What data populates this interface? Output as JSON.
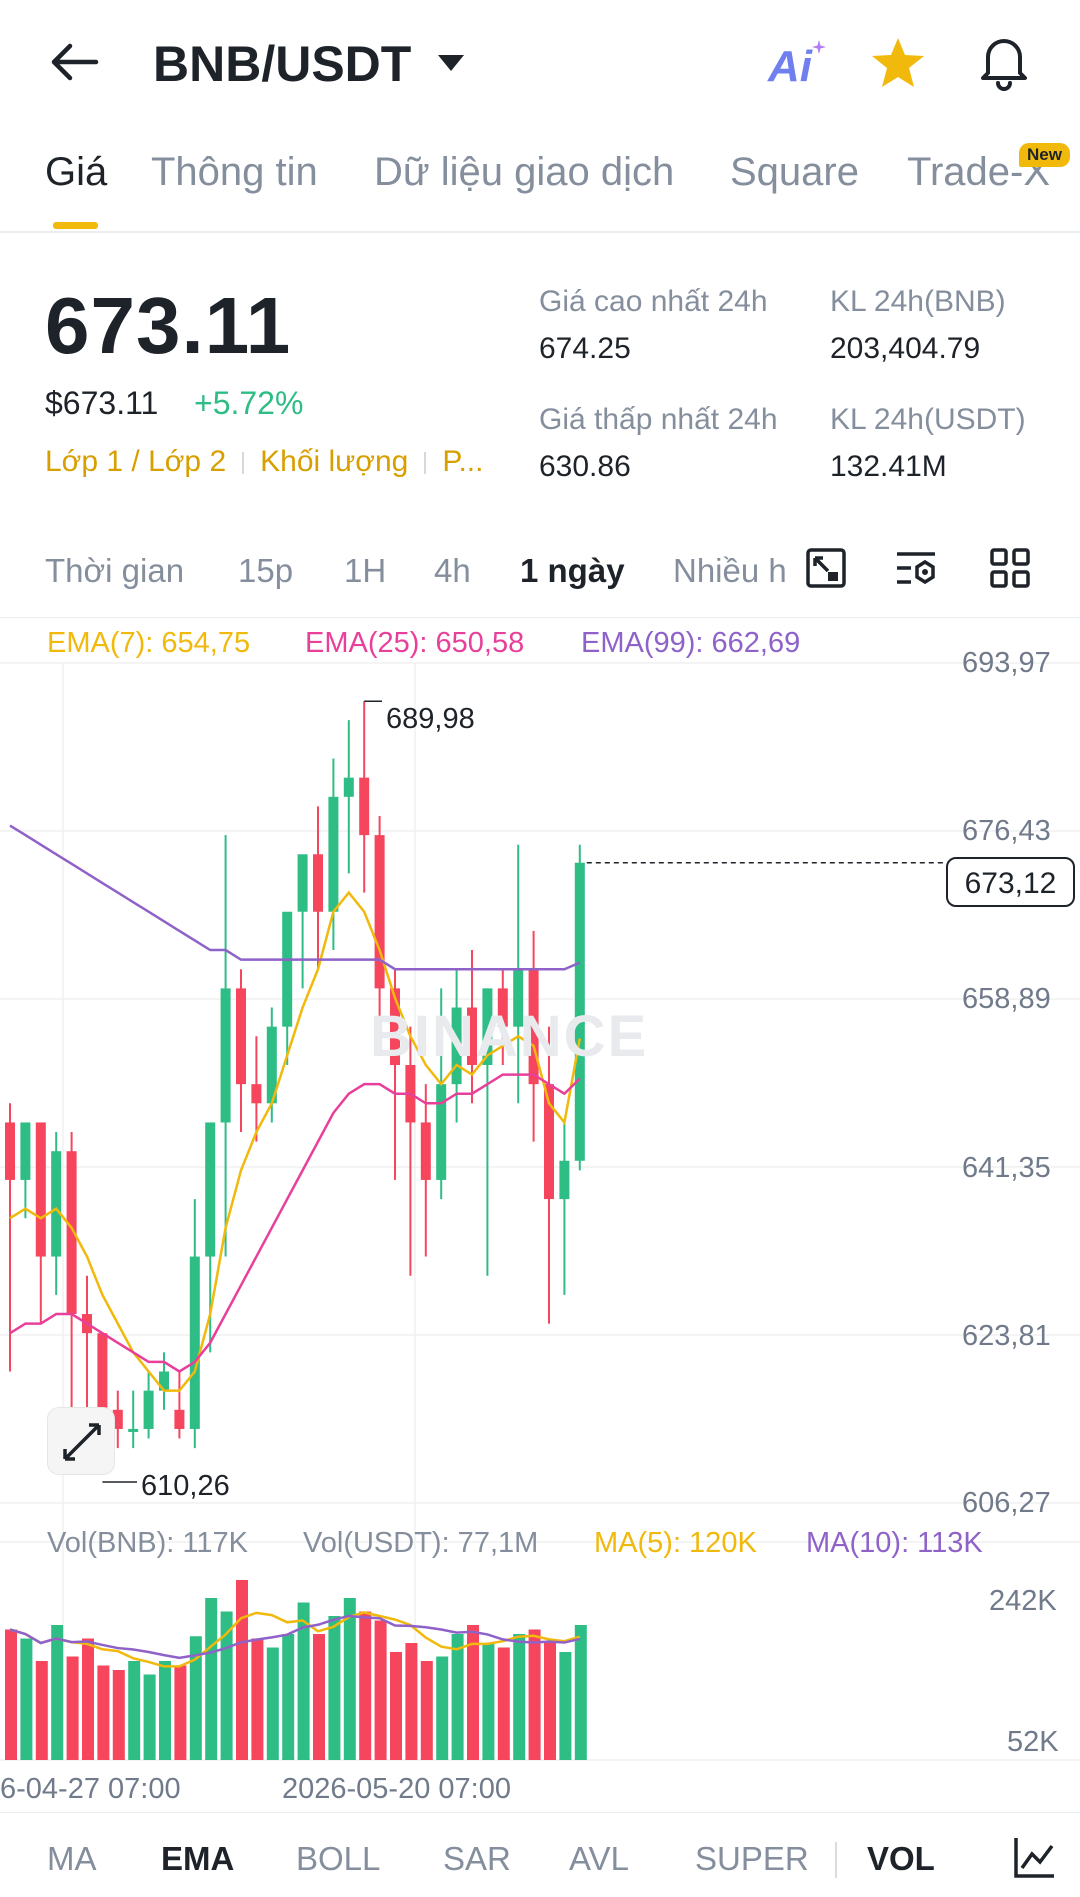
{
  "header": {
    "pair": "BNB/USDT",
    "ai_label": "Ai",
    "icons": [
      "back-arrow-icon",
      "caret-down-icon",
      "ai-icon",
      "star-icon",
      "bell-icon"
    ]
  },
  "tabs": [
    {
      "label": "Giá",
      "active": true
    },
    {
      "label": "Thông tin"
    },
    {
      "label": "Dữ liệu giao dịch"
    },
    {
      "label": "Square"
    },
    {
      "label": "Trade-X"
    }
  ],
  "new_badge": "New",
  "price": {
    "last": "673.11",
    "usd": "$673.11",
    "change": "+5.72%",
    "tags": [
      "Lớp 1 / Lớp 2",
      "Khối lượng",
      "P..."
    ]
  },
  "stats": {
    "high_label": "Giá cao nhất 24h",
    "high_value": "674.25",
    "low_label": "Giá thấp nhất 24h",
    "low_value": "630.86",
    "vol_bnb_label": "KL 24h(BNB)",
    "vol_bnb_value": "203,404.79",
    "vol_usdt_label": "KL 24h(USDT)",
    "vol_usdt_value": "132.41M"
  },
  "intervals": [
    "Thời gian",
    "15p",
    "1H",
    "4h",
    "1 ngày",
    "Nhiều h"
  ],
  "active_interval": "1 ngày",
  "toolbar_icons": [
    "chart-type-icon",
    "indicator-settings-icon",
    "grid-layout-icon"
  ],
  "ema_legend": {
    "ema7": "EMA(7): 654,75",
    "ema25": "EMA(25): 650,58",
    "ema99": "EMA(99): 662,69"
  },
  "price_axis": [
    "693,97",
    "676,43",
    "658,89",
    "641,35",
    "623,81",
    "606,27"
  ],
  "current_price_label": "673,12",
  "high_marker": "689,98",
  "low_marker": "610,26",
  "watermark": "BINANCE",
  "vol_legend": {
    "vol_bnb": "Vol(BNB): 117K",
    "vol_usdt": "Vol(USDT): 77,1M",
    "ma5": "MA(5): 120K",
    "ma10": "MA(10): 113K"
  },
  "vol_axis": [
    "242K",
    "52K"
  ],
  "time_axis": [
    "6-04-27 07:00",
    "2026-05-20 07:00"
  ],
  "indicators": [
    "MA",
    "EMA",
    "BOLL",
    "SAR",
    "AVL",
    "SUPER",
    "VOL"
  ],
  "active_indicators": [
    "EMA",
    "VOL"
  ],
  "colors": {
    "up": "#2ebd85",
    "down": "#f6465d",
    "brand": "#f0b90b",
    "ema7": "#f0b90b",
    "ema25": "#e8409a",
    "ema99": "#8f62c9"
  },
  "chart_data": {
    "type": "candlestick",
    "y_range": [
      606.27,
      693.97
    ],
    "candles": [
      {
        "o": 646,
        "h": 648,
        "c": 640,
        "l": 620
      },
      {
        "o": 640,
        "h": 646,
        "c": 646,
        "l": 636
      },
      {
        "o": 646,
        "h": 646,
        "c": 632,
        "l": 625
      },
      {
        "o": 632,
        "h": 645,
        "c": 643,
        "l": 628
      },
      {
        "o": 643,
        "h": 645,
        "c": 626,
        "l": 615
      },
      {
        "o": 626,
        "h": 630,
        "c": 624,
        "l": 614
      },
      {
        "o": 624,
        "h": 624,
        "c": 616,
        "l": 611
      },
      {
        "o": 616,
        "h": 618,
        "c": 614,
        "l": 612
      },
      {
        "o": 614,
        "h": 618,
        "c": 614,
        "l": 612
      },
      {
        "o": 614,
        "h": 620,
        "c": 618,
        "l": 613
      },
      {
        "o": 618,
        "h": 622,
        "c": 620,
        "l": 616
      },
      {
        "o": 616,
        "h": 620,
        "c": 614,
        "l": 613
      },
      {
        "o": 614,
        "h": 638,
        "c": 632,
        "l": 612
      },
      {
        "o": 632,
        "h": 640,
        "c": 646,
        "l": 622
      },
      {
        "o": 646,
        "h": 676,
        "c": 660,
        "l": 632
      },
      {
        "o": 660,
        "h": 662,
        "c": 650,
        "l": 645
      },
      {
        "o": 650,
        "h": 655,
        "c": 648,
        "l": 644
      },
      {
        "o": 648,
        "h": 658,
        "c": 656,
        "l": 646
      },
      {
        "o": 656,
        "h": 666,
        "c": 668,
        "l": 652
      },
      {
        "o": 668,
        "h": 670,
        "c": 674,
        "l": 660
      },
      {
        "o": 674,
        "h": 679,
        "c": 668,
        "l": 662
      },
      {
        "o": 668,
        "h": 684,
        "c": 680,
        "l": 664
      },
      {
        "o": 680,
        "h": 688,
        "c": 682,
        "l": 672
      },
      {
        "o": 682,
        "h": 689.98,
        "c": 676,
        "l": 670
      },
      {
        "o": 676,
        "h": 678,
        "c": 660,
        "l": 656
      },
      {
        "o": 660,
        "h": 662,
        "c": 652,
        "l": 640
      },
      {
        "o": 652,
        "h": 656,
        "c": 646,
        "l": 630
      },
      {
        "o": 646,
        "h": 650,
        "c": 640,
        "l": 632
      },
      {
        "o": 640,
        "h": 660,
        "c": 650,
        "l": 638
      },
      {
        "o": 650,
        "h": 662,
        "c": 658,
        "l": 646
      },
      {
        "o": 658,
        "h": 664,
        "c": 652,
        "l": 648
      },
      {
        "o": 652,
        "h": 660,
        "c": 660,
        "l": 630
      },
      {
        "o": 660,
        "h": 662,
        "c": 656,
        "l": 652
      },
      {
        "o": 656,
        "h": 675,
        "c": 662,
        "l": 648
      },
      {
        "o": 662,
        "h": 666,
        "c": 650,
        "l": 644
      },
      {
        "o": 650,
        "h": 656,
        "c": 638,
        "l": 625
      },
      {
        "o": 638,
        "h": 646,
        "c": 642,
        "l": 628
      },
      {
        "o": 642,
        "h": 675,
        "c": 673.12,
        "l": 641
      }
    ],
    "volumes": [
      58,
      54,
      44,
      60,
      46,
      54,
      42,
      40,
      44,
      38,
      44,
      42,
      55,
      72,
      66,
      80,
      54,
      50,
      56,
      70,
      56,
      64,
      72,
      66,
      62,
      48,
      52,
      44,
      46,
      56,
      60,
      52,
      50,
      56,
      58,
      52,
      48,
      60
    ],
    "series": [
      {
        "name": "EMA(7)",
        "values": [
          636,
          637,
          636,
          637,
          635,
          632,
          628,
          625,
          622,
          620,
          618,
          618,
          620,
          626,
          635,
          641,
          645,
          648,
          653,
          658,
          662,
          668,
          670,
          668,
          664,
          659,
          655,
          652,
          650,
          652,
          651,
          653,
          654,
          655,
          654,
          648,
          646,
          654.75
        ]
      },
      {
        "name": "EMA(25)",
        "values": [
          624,
          625,
          625,
          626,
          626,
          625,
          624,
          623,
          622,
          621,
          621,
          620,
          621,
          623,
          626,
          629,
          632,
          635,
          638,
          641,
          644,
          647,
          649,
          650,
          650,
          649,
          649,
          648,
          648,
          649,
          649,
          650,
          651,
          651,
          651,
          650,
          649,
          650.58
        ]
      },
      {
        "name": "EMA(99)",
        "values": [
          677,
          676,
          675,
          674,
          673,
          672,
          671,
          670,
          669,
          668,
          667,
          666,
          665,
          664,
          664,
          663,
          663,
          663,
          663,
          663,
          663,
          663,
          663,
          663,
          663,
          662,
          662,
          662,
          662,
          662,
          662,
          662,
          662,
          662,
          662,
          662,
          662,
          662.69
        ]
      }
    ]
  }
}
